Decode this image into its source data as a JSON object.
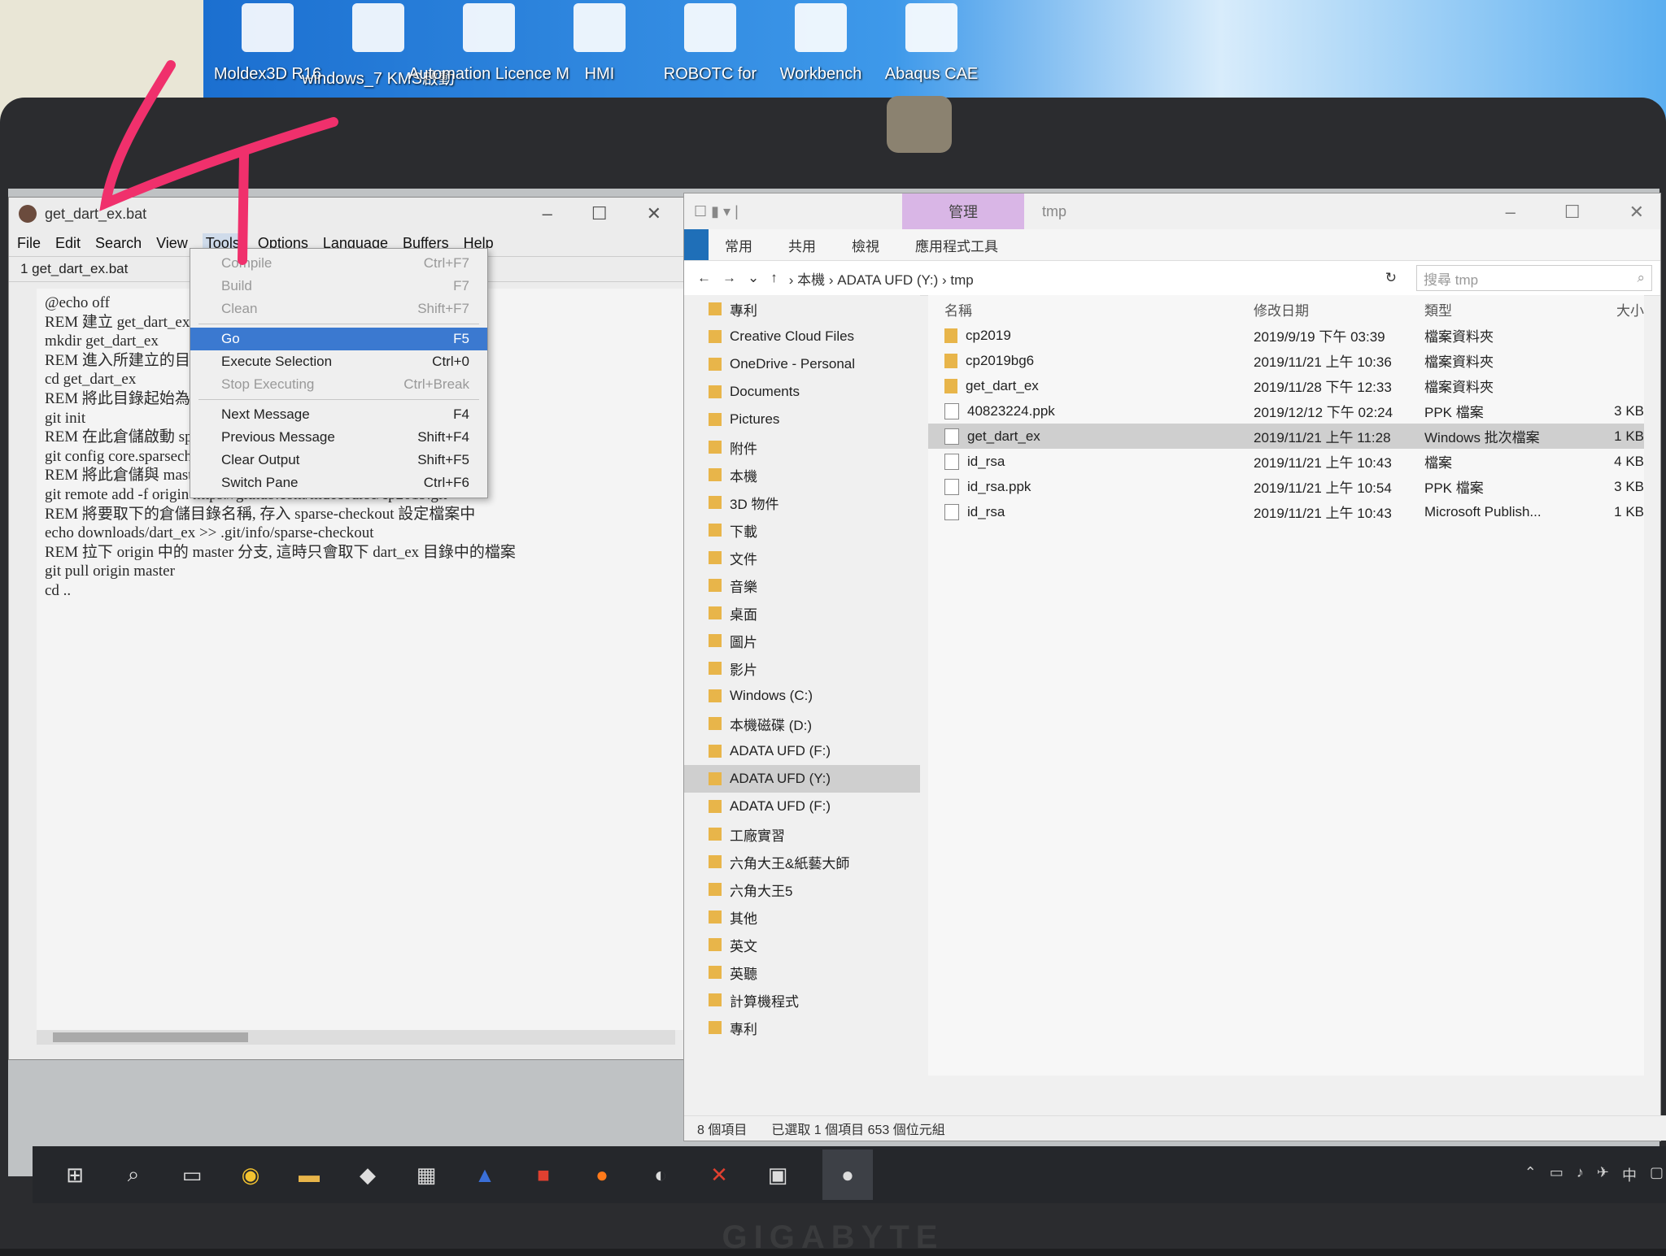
{
  "desktop": {
    "icons": [
      {
        "label": "Moldex3D R16"
      },
      {
        "label": "windows_7 KMS啟動"
      },
      {
        "label": "Automation Licence M"
      },
      {
        "label": "HMI"
      },
      {
        "label": "ROBOTC for"
      },
      {
        "label": "Workbench"
      },
      {
        "label": "Abaqus CAE"
      }
    ],
    "annotation": "4"
  },
  "editor": {
    "title": "get_dart_ex.bat",
    "menu": [
      "File",
      "Edit",
      "Search",
      "View",
      "Tools",
      "Options",
      "Language",
      "Buffers",
      "Help"
    ],
    "active_menu": "Tools",
    "tab_label": "1 get_dart_ex.bat",
    "code_lines": [
      "@echo off",
      "REM 建立 get_dart_ex 目錄",
      "mkdir get_dart_ex",
      "REM 進入所建立的目錄",
      "cd get_dart_ex",
      "REM 將此目錄起始為倉儲",
      "git init",
      "REM 在此倉儲啟動 sparse checkout",
      "git config core.sparsecheckout true",
      "REM 將此倉儲與 master 倉儲連結命名為 origin",
      "git remote add -f origin https://github.com/mdecourse/cp2019.git",
      "REM 將要取下的倉儲目錄名稱, 存入 sparse-checkout 設定檔案中",
      "echo downloads/dart_ex >> .git/info/sparse-checkout",
      "REM 拉下 origin 中的 master 分支, 這時只會取下 dart_ex 目錄中的檔案",
      "git pull origin master",
      "cd .."
    ],
    "tools_menu": [
      {
        "label": "Compile",
        "shortcut": "Ctrl+F7",
        "state": "disabled"
      },
      {
        "label": "Build",
        "shortcut": "F7",
        "state": "disabled"
      },
      {
        "label": "Clean",
        "shortcut": "Shift+F7",
        "state": "disabled"
      },
      {
        "label": "Go",
        "shortcut": "F5",
        "state": "selected"
      },
      {
        "label": "Execute Selection",
        "shortcut": "Ctrl+0",
        "state": "normal"
      },
      {
        "label": "Stop Executing",
        "shortcut": "Ctrl+Break",
        "state": "disabled"
      },
      {
        "label": "Next Message",
        "shortcut": "F4",
        "state": "normal"
      },
      {
        "label": "Previous Message",
        "shortcut": "Shift+F4",
        "state": "normal"
      },
      {
        "label": "Clear Output",
        "shortcut": "Shift+F5",
        "state": "normal"
      },
      {
        "label": "Switch Pane",
        "shortcut": "Ctrl+F6",
        "state": "normal"
      }
    ]
  },
  "explorer": {
    "ribbon_context": "管理",
    "window_title": "tmp",
    "ribbon_tabs": [
      "常用",
      "共用",
      "檢視",
      "應用程式工具"
    ],
    "breadcrumb": [
      "本機",
      "ADATA UFD (Y:)",
      "tmp"
    ],
    "search_placeholder": "搜尋 tmp",
    "nav_items": [
      {
        "label": "專利",
        "selected": false
      },
      {
        "label": "Creative Cloud Files",
        "selected": false
      },
      {
        "label": "OneDrive - Personal",
        "selected": false
      },
      {
        "label": "Documents",
        "selected": false
      },
      {
        "label": "Pictures",
        "selected": false
      },
      {
        "label": "附件",
        "selected": false
      },
      {
        "label": "本機",
        "selected": false
      },
      {
        "label": "3D 物件",
        "selected": false
      },
      {
        "label": "下載",
        "selected": false
      },
      {
        "label": "文件",
        "selected": false
      },
      {
        "label": "音樂",
        "selected": false
      },
      {
        "label": "桌面",
        "selected": false
      },
      {
        "label": "圖片",
        "selected": false
      },
      {
        "label": "影片",
        "selected": false
      },
      {
        "label": "Windows (C:)",
        "selected": false
      },
      {
        "label": "本機磁碟 (D:)",
        "selected": false
      },
      {
        "label": "ADATA UFD (F:)",
        "selected": false
      },
      {
        "label": "ADATA UFD (Y:)",
        "selected": true
      },
      {
        "label": "ADATA UFD (F:)",
        "selected": false
      },
      {
        "label": "工廠實習",
        "selected": false
      },
      {
        "label": "六角大王&紙藝大師",
        "selected": false
      },
      {
        "label": "六角大王5",
        "selected": false
      },
      {
        "label": "其他",
        "selected": false
      },
      {
        "label": "英文",
        "selected": false
      },
      {
        "label": "英聽",
        "selected": false
      },
      {
        "label": "計算機程式",
        "selected": false
      },
      {
        "label": "專利",
        "selected": false
      }
    ],
    "columns": [
      "名稱",
      "修改日期",
      "類型",
      "大小"
    ],
    "files": [
      {
        "name": "cp2019",
        "date": "2019/9/19 下午 03:39",
        "type": "檔案資料夾",
        "size": "",
        "kind": "folder",
        "selected": false
      },
      {
        "name": "cp2019bg6",
        "date": "2019/11/21 上午 10:36",
        "type": "檔案資料夾",
        "size": "",
        "kind": "folder",
        "selected": false
      },
      {
        "name": "get_dart_ex",
        "date": "2019/11/28 下午 12:33",
        "type": "檔案資料夾",
        "size": "",
        "kind": "folder",
        "selected": false
      },
      {
        "name": "40823224.ppk",
        "date": "2019/12/12 下午 02:24",
        "type": "PPK 檔案",
        "size": "3 KB",
        "kind": "file",
        "selected": false
      },
      {
        "name": "get_dart_ex",
        "date": "2019/11/21 上午 11:28",
        "type": "Windows 批次檔案",
        "size": "1 KB",
        "kind": "file",
        "selected": true
      },
      {
        "name": "id_rsa",
        "date": "2019/11/21 上午 10:43",
        "type": "檔案",
        "size": "4 KB",
        "kind": "file",
        "selected": false
      },
      {
        "name": "id_rsa.ppk",
        "date": "2019/11/21 上午 10:54",
        "type": "PPK 檔案",
        "size": "3 KB",
        "kind": "file",
        "selected": false
      },
      {
        "name": "id_rsa",
        "date": "2019/11/21 上午 10:43",
        "type": "Microsoft Publish...",
        "size": "1 KB",
        "kind": "file",
        "selected": false
      }
    ],
    "status_count": "8 個項目",
    "status_selected": "已選取 1 個項目 653 個位元組"
  },
  "taskbar": {
    "tray_lang": "中"
  },
  "colors": {
    "menu_highlight": "#3b79d0",
    "manage_tab": "#d9b6e6",
    "annotation_pink": "#f0306c"
  }
}
